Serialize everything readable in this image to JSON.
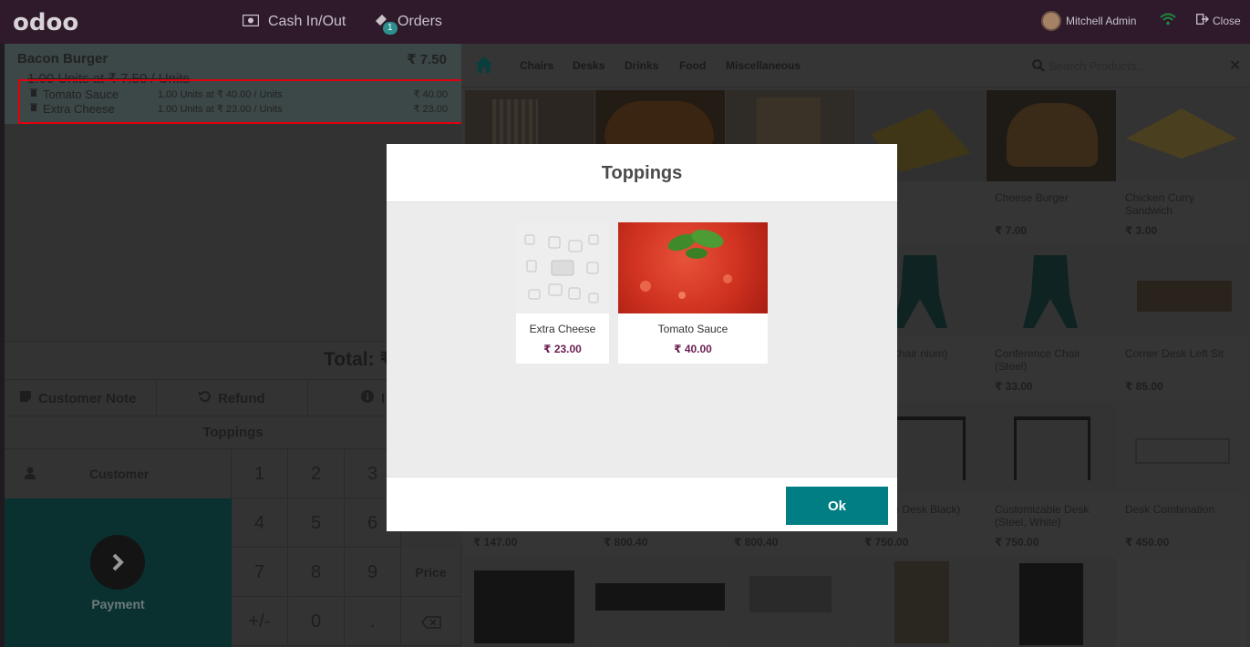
{
  "navbar": {
    "logo": "odoo",
    "cash_label": "Cash In/Out",
    "orders_label": "Orders",
    "orders_badge": "1",
    "user_name": "Mitchell Admin",
    "close_label": "Close"
  },
  "order": {
    "product": "Bacon Burger",
    "price": "₹ 7.50",
    "info": "1.00 Units at ₹ 7.50 / Units",
    "toppings": [
      {
        "name": "Tomato Sauce",
        "detail": "1.00  Units  at  ₹ 40.00  /  Units",
        "price": "₹ 40.00"
      },
      {
        "name": "Extra Cheese",
        "detail": "1.00  Units  at  ₹ 23.00  /  Units",
        "price": "₹ 23.00"
      }
    ],
    "total_label": "Total: ₹"
  },
  "controls": {
    "customer_note": "Customer Note",
    "refund": "Refund",
    "info": "I",
    "toppings": "Toppings",
    "customer": "Customer",
    "payment": "Payment",
    "price": "Price"
  },
  "numpad": [
    "1",
    "2",
    "3",
    "4",
    "5",
    "6",
    "7",
    "8",
    "9",
    "+/-",
    "0",
    "."
  ],
  "categories": [
    "Chairs",
    "Desks",
    "Drinks",
    "Food",
    "Miscellaneous"
  ],
  "search": {
    "placeholder": "Search Products..."
  },
  "products": [
    {
      "name": "",
      "price": ""
    },
    {
      "name": "",
      "price": ""
    },
    {
      "name": "",
      "price": ""
    },
    {
      "name": "",
      "price": ""
    },
    {
      "name": "Cheese Burger",
      "price": "₹ 7.00"
    },
    {
      "name": "Chicken Curry Sandwich",
      "price": "₹ 3.00"
    },
    {
      "name": "ence Chair nium)",
      "price": ""
    },
    {
      "name": "Conference Chair (Steel)",
      "price": "₹ 33.00"
    },
    {
      "name": "Corner Desk Left Sit",
      "price": "₹ 85.00"
    },
    {
      "name": "",
      "price": "₹ 147.00"
    },
    {
      "name": "",
      "price": "₹ 800.40"
    },
    {
      "name": "",
      "price": "₹ 800.40"
    },
    {
      "name": "nizable Desk Black)",
      "price": "₹ 750.00"
    },
    {
      "name": "Customizable Desk (Steel, White)",
      "price": "₹ 750.00"
    },
    {
      "name": "Desk Combination",
      "price": "₹ 450.00"
    }
  ],
  "modal": {
    "title": "Toppings",
    "items": [
      {
        "name": "Extra Cheese",
        "price": "₹ 23.00"
      },
      {
        "name": "Tomato Sauce",
        "price": "₹ 40.00"
      }
    ],
    "ok_label": "Ok"
  }
}
